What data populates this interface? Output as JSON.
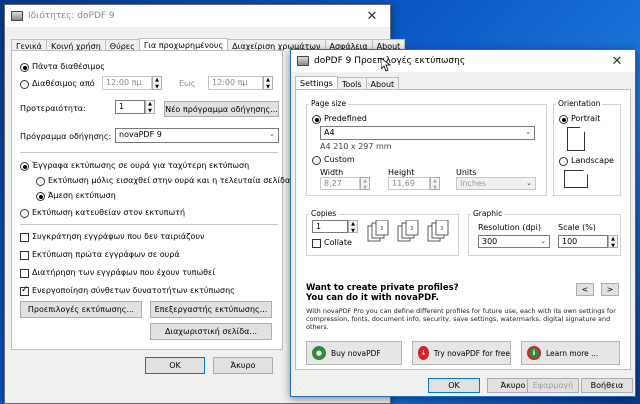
{
  "props": {
    "title": "Ιδιότητες: doPDF 9",
    "tabs": [
      "Γενικά",
      "Κοινή χρήση",
      "Θύρες",
      "Για προχωρημένους",
      "Διαχείριση χρωμάτων",
      "Ασφάλεια",
      "About"
    ],
    "always_available": "Πάντα διαθέσιμος",
    "available_from": "Διαθέσιμος από",
    "from_time": "12:00 πμ",
    "until_label": "Εως",
    "until_time": "12:00 πμ",
    "priority_label": "Προτεραιότητα:",
    "priority_value": "1",
    "new_driver_button": "Νέο πρόγραμμα οδήγησης...",
    "driver_label": "Πρόγραμμα οδήγησης:",
    "driver_value": "novaPDF 9",
    "spool_option": "Έγγραφα εκτύπωσης σε ουρά για ταχύτερη εκτύπωση",
    "spool_after_last": "Εκτύπωση μόλις εισαχθεί στην ουρά και η τελευταία σελίδα",
    "spool_immediate": "Άμεση εκτύπωση",
    "direct_print": "Εκτύπωση κατευθείαν στον εκτυπωτή",
    "hold_mismatched": "Συγκράτηση εγγράφων που δεν ταιριάζουν",
    "print_spooled_first": "Εκτύπωση πρώτα εγγράφων σε ουρά",
    "keep_printed": "Διατήρηση των εγγράφων που έχουν τυπωθεί",
    "advanced_features": "Ενεργοποίηση σύνθετων δυνατοτήτων εκτύπωσης",
    "defaults_button": "Προεπιλογές εκτύπωσης...",
    "processor_button": "Επεξεργαστής εκτύπωσης...",
    "separator_button": "Διαχωριστική σελίδα...",
    "ok": "OK",
    "cancel": "Άκυρο"
  },
  "prefs": {
    "title": "doPDF 9 Προεπιλογές εκτύπωσης",
    "tabs": [
      "Settings",
      "Tools",
      "About"
    ],
    "page_size_label": "Page size",
    "predefined_label": "Predefined",
    "paper_value": "A4",
    "paper_dims": "A4 210 x 297 mm",
    "custom_label": "Custom",
    "width_label": "Width",
    "width_value": "8,27",
    "height_label": "Height",
    "height_value": "11,69",
    "units_label": "Units",
    "units_value": "Inches",
    "orientation_label": "Orientation",
    "portrait_label": "Portrait",
    "landscape_label": "Landscape",
    "copies_label": "Copies",
    "copies_value": "1",
    "collate_label": "Collate",
    "graphic_label": "Graphic",
    "resolution_label": "Resolution (dpi)",
    "resolution_value": "300",
    "scale_label": "Scale (%)",
    "scale_value": "100",
    "promo_line1": "Want to create private profiles?",
    "promo_line2": "You can do it with novaPDF.",
    "promo_body": "With novaPDF Pro you can define different profiles for future use, each with its own settings for compression, fonts, document info, security, save settings, watermarks, digital signature and others.",
    "nav_prev": "<",
    "nav_next": ">",
    "buy_label": "Buy novaPDF",
    "try_label": "Try novaPDF for free",
    "learn_label": "Learn more ...",
    "ok": "OK",
    "cancel": "Άκυρο",
    "apply": "Εφαρμογή",
    "help": "Βοήθεια"
  },
  "colors": {
    "buy_icon": "#2e8b3a",
    "try_icon": "#d2232a",
    "learn_icon": "#2e8b3a"
  }
}
